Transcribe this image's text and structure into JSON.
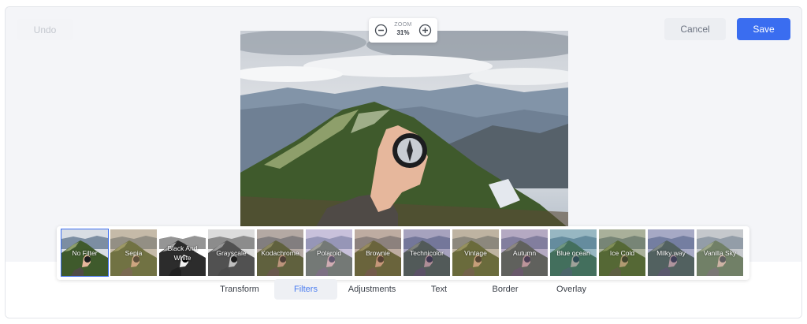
{
  "toolbar": {
    "undo_label": "Undo",
    "cancel_label": "Cancel",
    "save_label": "Save"
  },
  "zoom": {
    "label": "ZOOM",
    "value": "31%"
  },
  "filters": [
    {
      "label": "No Filter",
      "tint": "",
      "selected": true
    },
    {
      "label": "Sepia",
      "tint": "#b09060"
    },
    {
      "label": "Black And White",
      "tint": "bw"
    },
    {
      "label": "Grayscale",
      "tint": "gray"
    },
    {
      "label": "Kodachrome",
      "tint": "#8a6a55"
    },
    {
      "label": "Polaroid",
      "tint": "#b6a0d0"
    },
    {
      "label": "Brownie",
      "tint": "#a07050"
    },
    {
      "label": "Technicolor",
      "tint": "#6a5a90"
    },
    {
      "label": "Vintage",
      "tint": "#a08050"
    },
    {
      "label": "Autumn",
      "tint": "#8a6a98"
    },
    {
      "label": "Blue ocean",
      "tint": "#4a8a9a"
    },
    {
      "label": "Ice Cold",
      "tint": "#707a40"
    },
    {
      "label": "Milky way",
      "tint": "#6a6aa0"
    },
    {
      "label": "Vanilla Sky",
      "tint": "#b0b0b0"
    }
  ],
  "tabs": [
    {
      "label": "Transform",
      "active": false
    },
    {
      "label": "Filters",
      "active": true
    },
    {
      "label": "Adjustments",
      "active": false
    },
    {
      "label": "Text",
      "active": false
    },
    {
      "label": "Border",
      "active": false
    },
    {
      "label": "Overlay",
      "active": false
    }
  ],
  "colors": {
    "accent": "#3a6df0",
    "active_tab_text": "#4a7cf0"
  },
  "icons": {
    "zoom_out": "minus-circle-icon",
    "zoom_in": "plus-circle-icon"
  }
}
